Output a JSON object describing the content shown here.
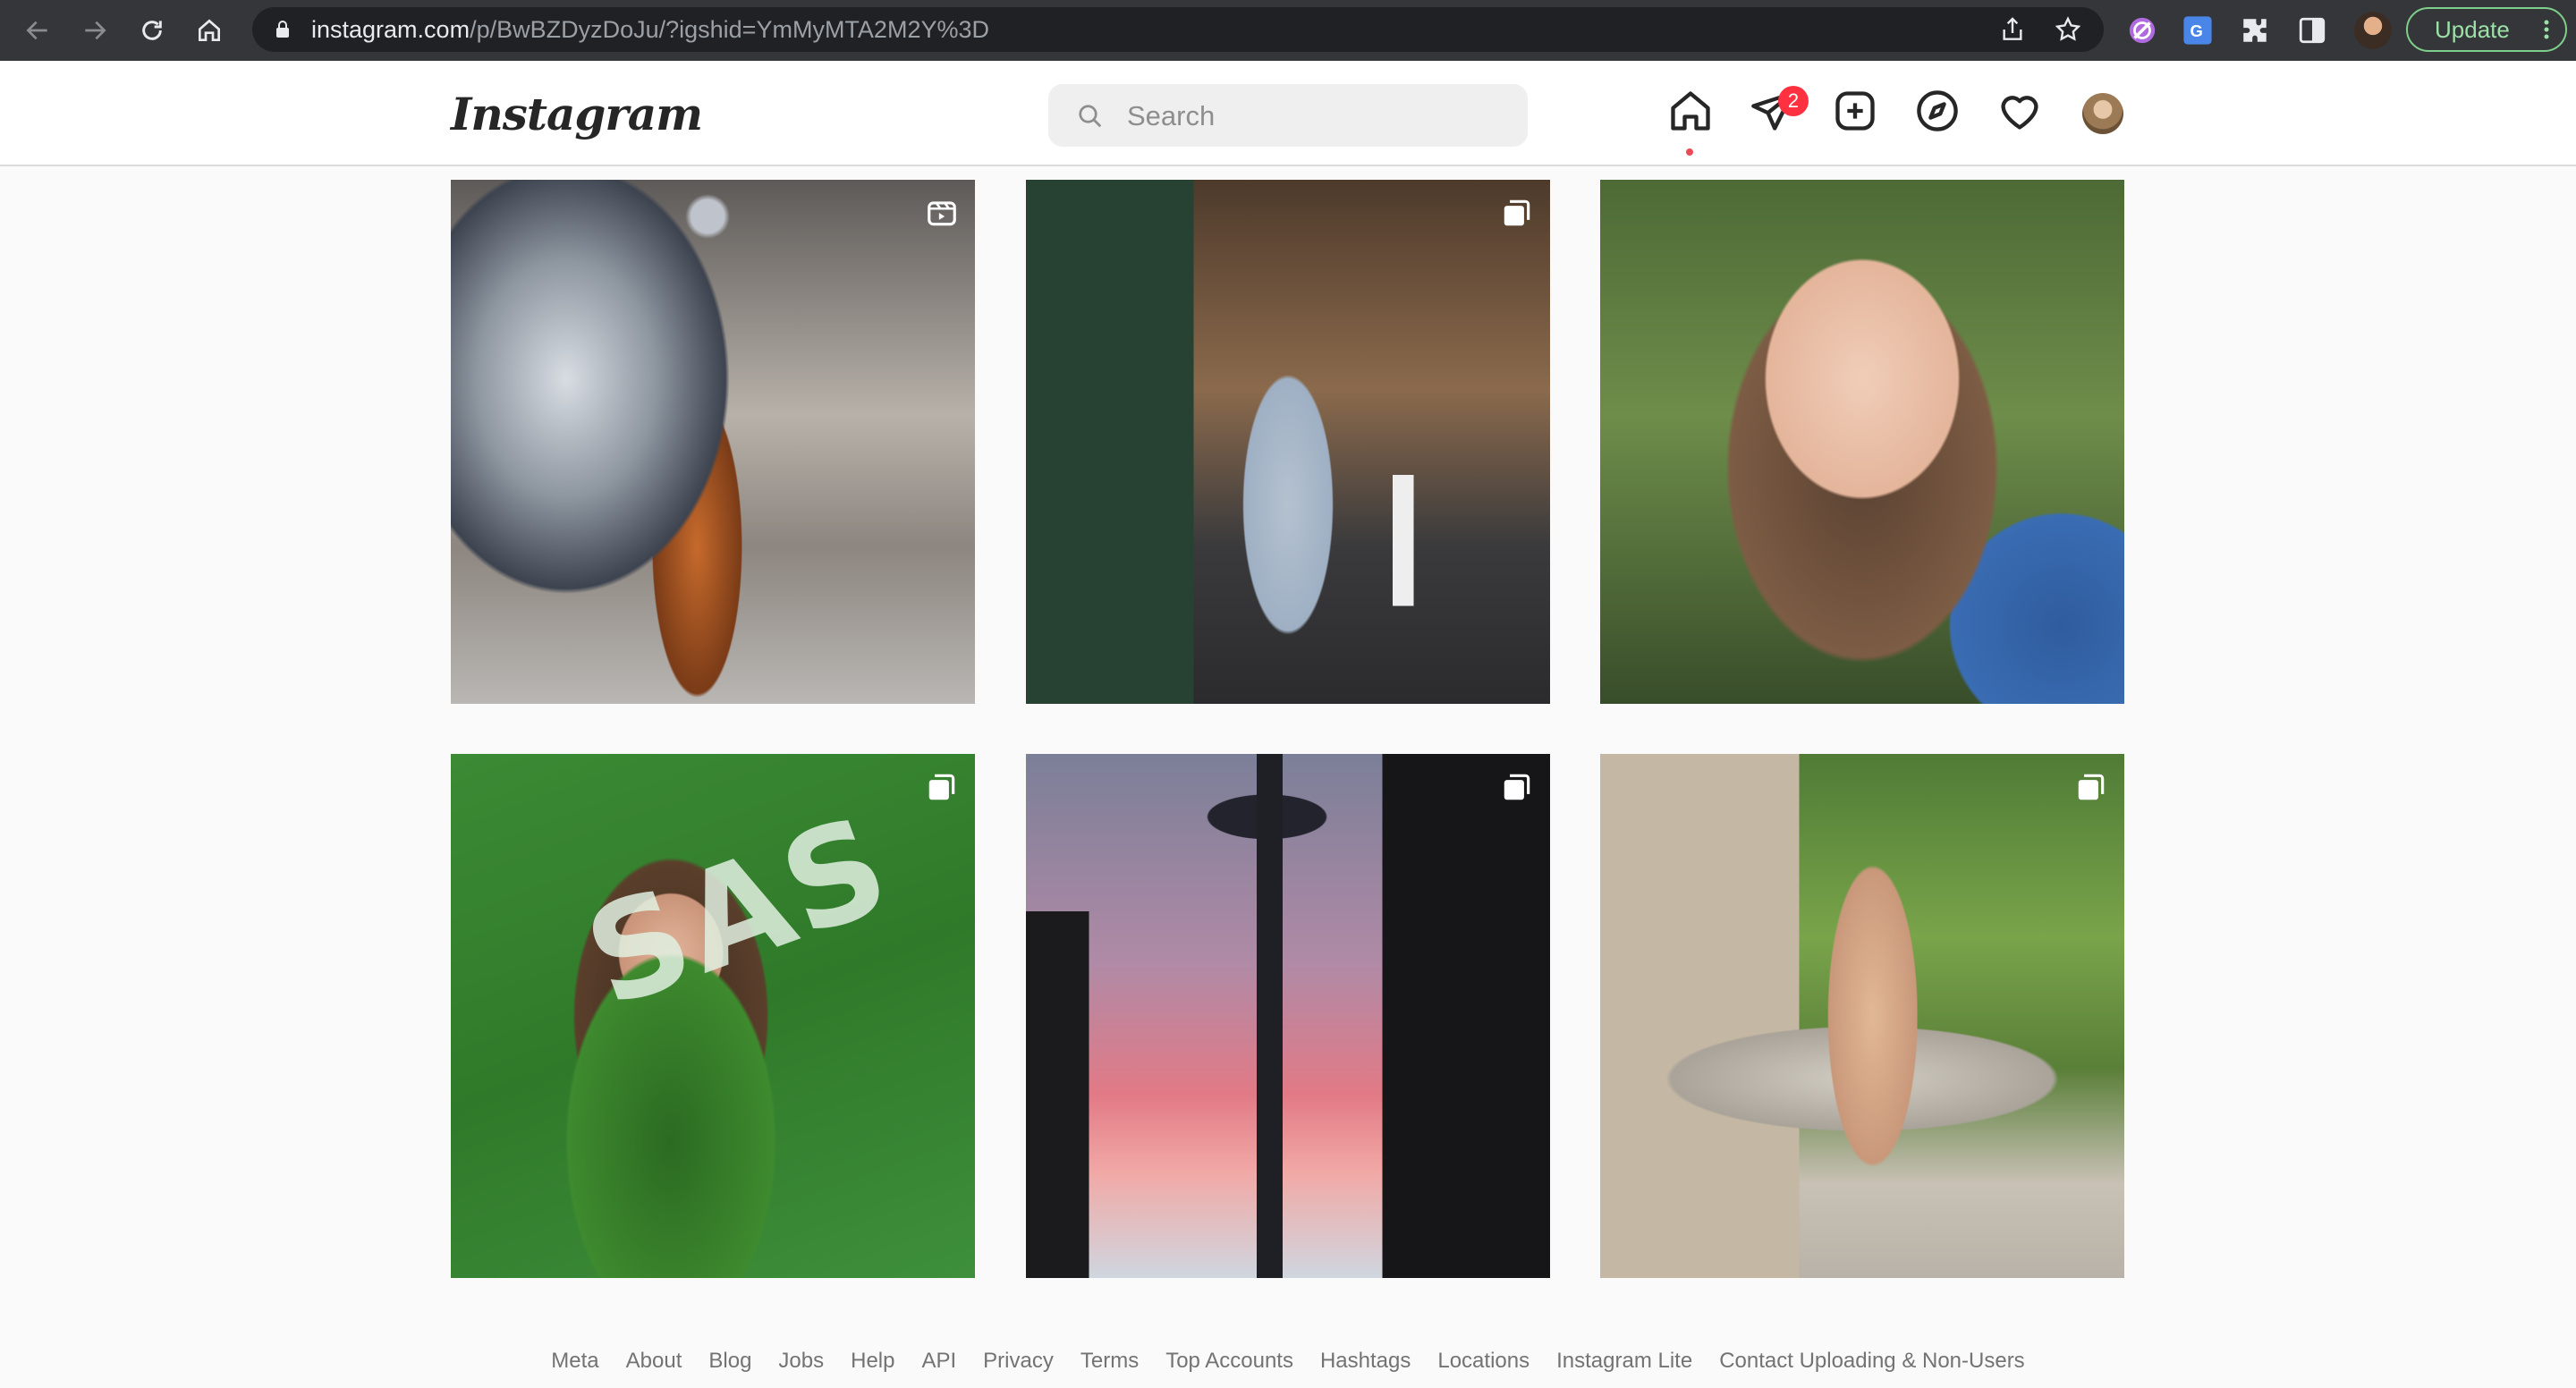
{
  "browser": {
    "url_host": "instagram.com",
    "url_path": "/p/BwBZDyzDoJu/?igshid=YmMyMTA2M2Y%3D",
    "update_label": "Update"
  },
  "header": {
    "logo_text": "Instagram",
    "search_placeholder": "Search",
    "messages_badge": "2",
    "notification_color": "#ff3040"
  },
  "grid": {
    "tiles": [
      {
        "id": "photo-1",
        "type_icon": "reel-icon"
      },
      {
        "id": "photo-2",
        "type_icon": "multi-photo-icon"
      },
      {
        "id": "photo-3",
        "type_icon": null
      },
      {
        "id": "photo-4",
        "type_icon": "multi-photo-icon",
        "visible_text": "SAS"
      },
      {
        "id": "photo-5",
        "type_icon": "multi-photo-icon"
      },
      {
        "id": "photo-6",
        "type_icon": "multi-photo-icon"
      }
    ]
  },
  "footer": {
    "links": [
      "Meta",
      "About",
      "Blog",
      "Jobs",
      "Help",
      "API",
      "Privacy",
      "Terms",
      "Top Accounts",
      "Hashtags",
      "Locations",
      "Instagram Lite",
      "Contact Uploading & Non-Users"
    ]
  }
}
